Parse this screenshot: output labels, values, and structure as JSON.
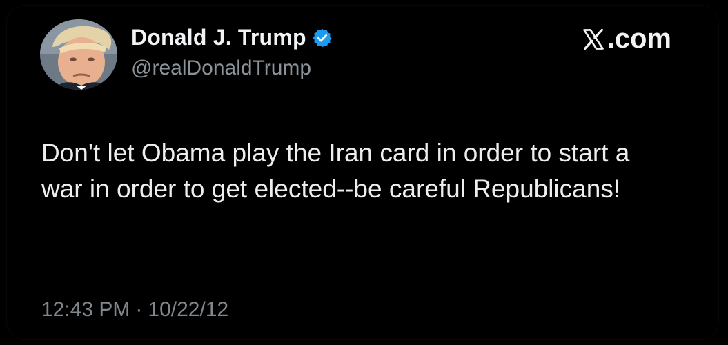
{
  "author": {
    "name": "Donald J. Trump",
    "handle": "@realDonaldTrump"
  },
  "brand": {
    "label": ".com",
    "icon": "x-logo-icon"
  },
  "icons": {
    "verified": "verified-badge-icon"
  },
  "colors": {
    "background": "#000000",
    "text": "#e7e9ea",
    "secondary_text": "#8b939a",
    "verified_badge": "#1d9bf0"
  },
  "post": {
    "text": "Don't let Obama play the Iran card in order to start a war in order to get elected--be careful Republicans!",
    "time": "12:43 PM",
    "separator": "·",
    "date": "10/22/12"
  }
}
